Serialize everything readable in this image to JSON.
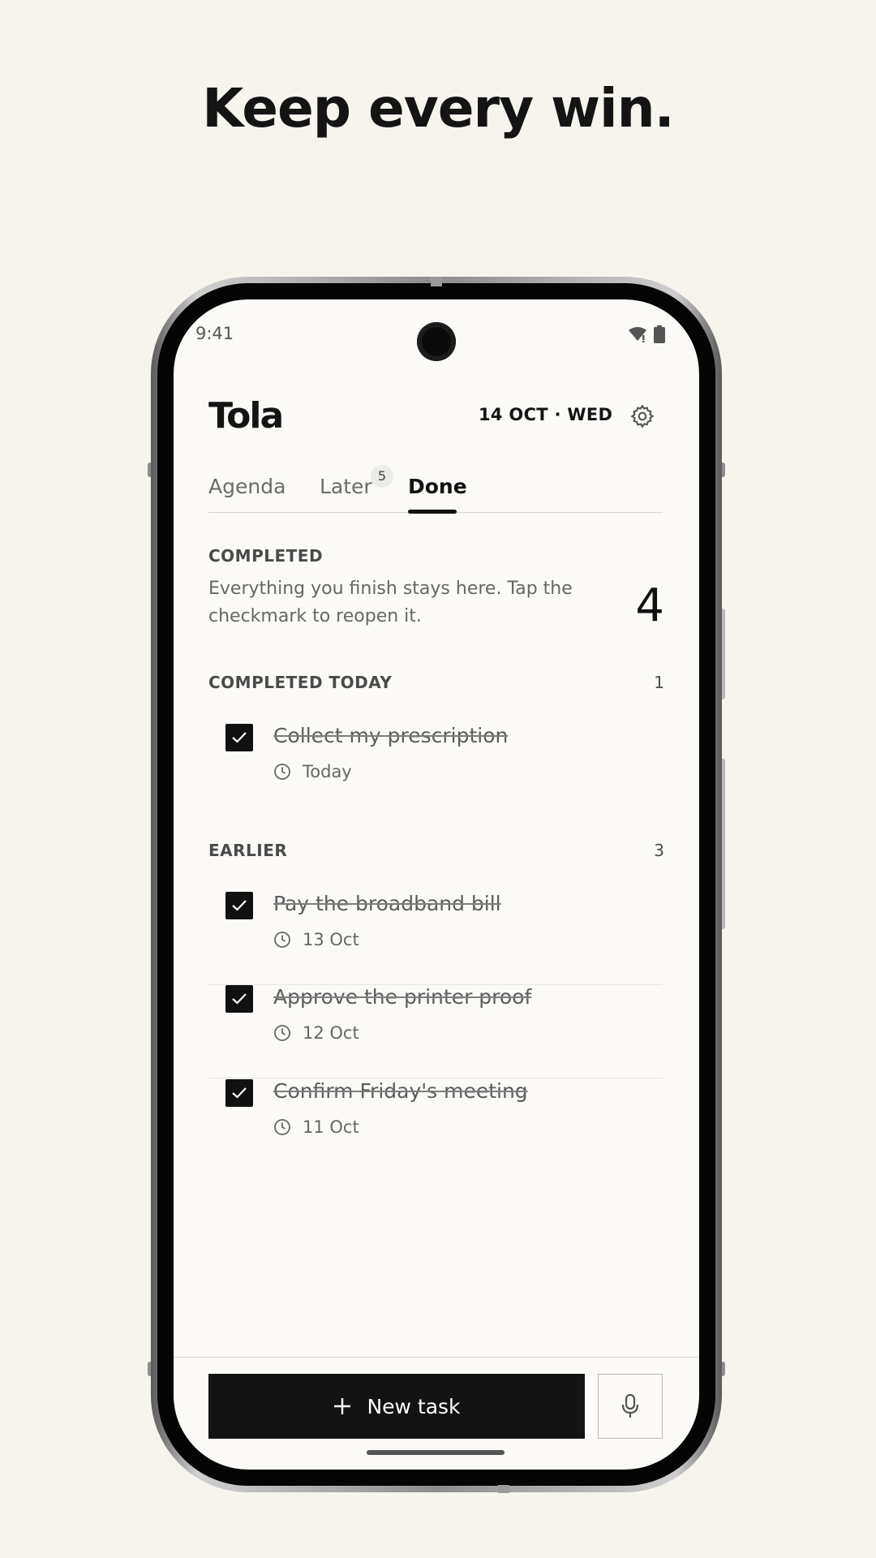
{
  "headline": "Keep every win.",
  "status_bar": {
    "time": "9:41",
    "icons": [
      "wifi-icon",
      "battery-icon"
    ]
  },
  "app": {
    "title": "Tola",
    "date": "14 OCT · WED",
    "settings_icon": "gear-icon"
  },
  "tabs": [
    {
      "label": "Agenda",
      "active": false
    },
    {
      "label": "Later",
      "badge": "5",
      "active": false
    },
    {
      "label": "Done",
      "active": true
    }
  ],
  "completed": {
    "label": "COMPLETED",
    "description": "Everything you finish stays here. Tap the checkmark to reopen it.",
    "count": "4"
  },
  "today": {
    "label": "COMPLETED TODAY",
    "count": "1",
    "tasks": [
      {
        "title": "Collect my prescription",
        "date": "Today"
      }
    ]
  },
  "earlier": {
    "label": "EARLIER",
    "count": "3",
    "tasks": [
      {
        "title": "Pay the broadband bill",
        "date": "13 Oct"
      },
      {
        "title": "Approve the printer proof",
        "date": "12 Oct"
      },
      {
        "title": "Confirm Friday's meeting",
        "date": "11 Oct"
      }
    ]
  },
  "bottom": {
    "new_task_label": "New task",
    "mic_icon": "microphone-icon"
  },
  "colors": {
    "background": "#f7f4ee",
    "screen": "#fbfaf7",
    "ink": "#131313"
  }
}
